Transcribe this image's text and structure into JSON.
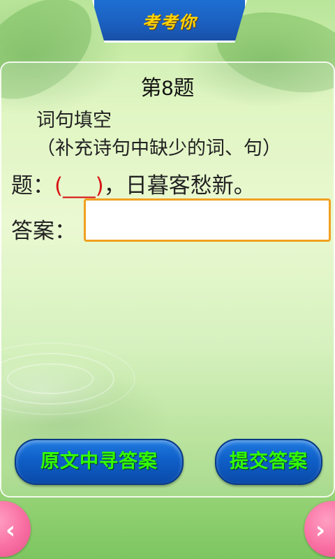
{
  "header": {
    "title": "考考你"
  },
  "question": {
    "heading": "第8题",
    "type_label": "词句填空",
    "hint": "（补充诗句中缺少的词、句）",
    "prefix": "题：",
    "blank": "(___)",
    "suffix": "，日暮客愁新。"
  },
  "answer": {
    "label": "答案：",
    "value": "",
    "placeholder": ""
  },
  "buttons": {
    "guide_label": "原文中寻答案",
    "submit_label": "提交答案"
  },
  "nav": {
    "prev_icon": "chevron-left-icon",
    "next_icon": "chevron-right-icon"
  },
  "colors": {
    "title_tab": "#1d6fd1",
    "title_text": "#ffd400",
    "blank_text": "#d81414",
    "input_border": "#f0a020",
    "button_text": "#33ff00",
    "nav_button": "#f86fa2"
  }
}
